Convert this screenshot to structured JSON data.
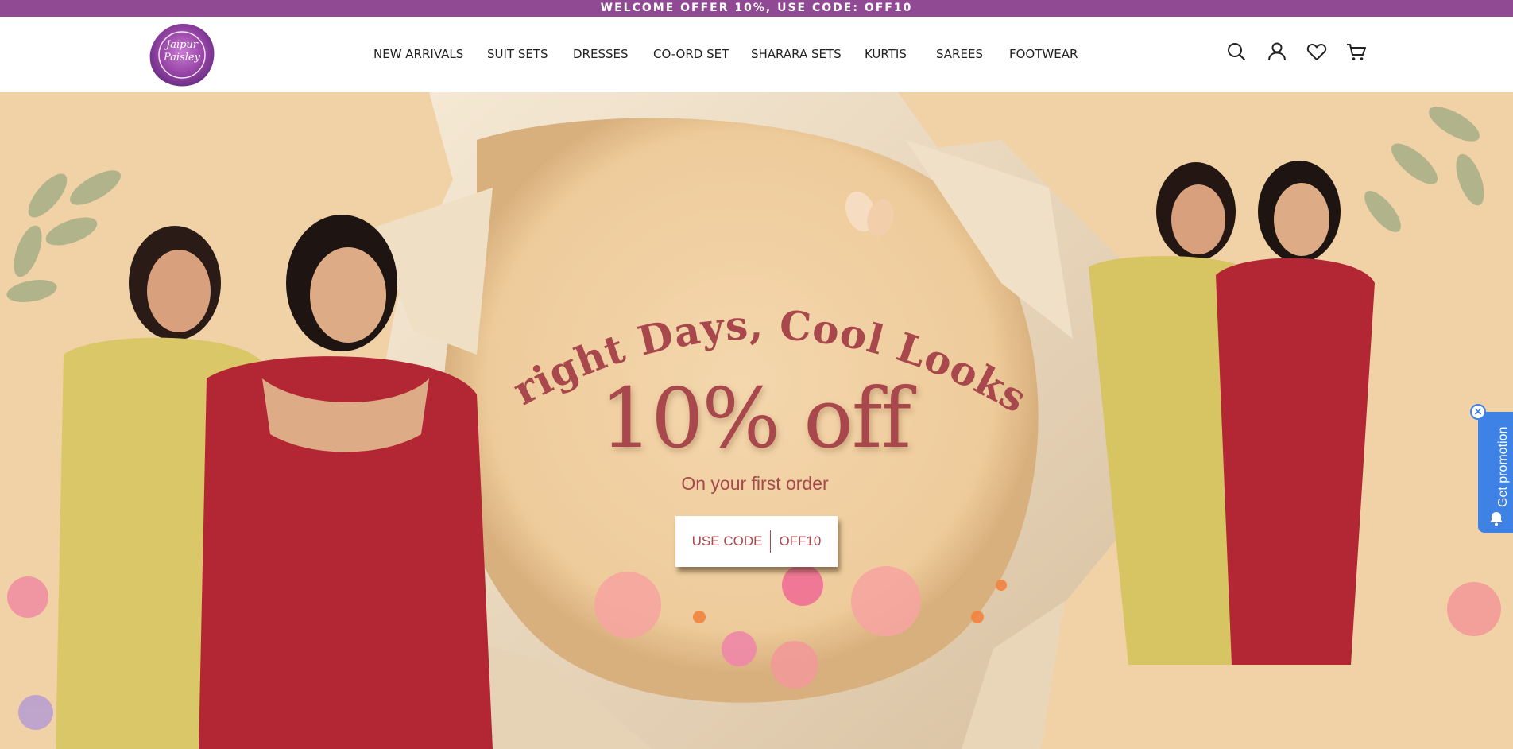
{
  "announcement": {
    "text": "WELCOME OFFER 10%, USE CODE: OFF10"
  },
  "brand": {
    "logo_text": "Jaipur Paisley"
  },
  "nav": {
    "items": [
      {
        "label": "NEW ARRIVALS"
      },
      {
        "label": "SUIT SETS"
      },
      {
        "label": "DRESSES"
      },
      {
        "label": "CO-ORD SET"
      },
      {
        "label": "SHARARA SETS"
      },
      {
        "label": "KURTIS"
      },
      {
        "label": "SAREES"
      },
      {
        "label": "FOOTWEAR"
      }
    ]
  },
  "header_icons": [
    "search-icon",
    "account-icon",
    "wishlist-heart-icon",
    "cart-icon"
  ],
  "hero": {
    "headline": "Bright Days, Cool Looks!",
    "offer": "10% off",
    "subtitle": "On your first order",
    "code_label": "USE CODE",
    "code_value": "OFF10"
  },
  "promo_widget": {
    "label": "Get promotion",
    "close": "×"
  },
  "colors": {
    "announcement_bg": "#8f4a93",
    "hero_bg": "#f1d2a6",
    "hero_text": "#a8474c",
    "promo_blue": "#3e82e6"
  }
}
